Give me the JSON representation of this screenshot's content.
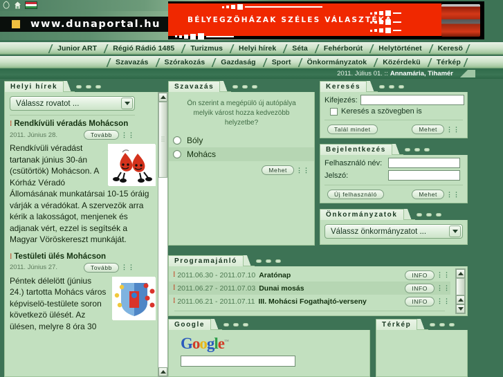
{
  "site": {
    "url_text": "www.dunaportal.hu",
    "icons": [
      "leaf-icon",
      "home-icon",
      "hungarian-flag-icon"
    ]
  },
  "banner": {
    "text": "BÉLYEGZÖHÁZAK SZÉLES VÁLASZTÉKA",
    "bg_color": "#f02800"
  },
  "nav": {
    "row1": [
      "Junior ART",
      "Régió Rádió 1485",
      "Turizmus",
      "Helyi hírek",
      "Séta",
      "Fehérborút",
      "Helytörténet",
      "Keresö"
    ],
    "row2": [
      "Szavazás",
      "Szórakozás",
      "Gazdaság",
      "Sport",
      "Önkormányzatok",
      "Közérdekü",
      "Térkép"
    ]
  },
  "datebar": {
    "date": "2011. Július 01. ::",
    "names": "Annamária, Tihamér"
  },
  "local_news": {
    "title": "Helyi hírek",
    "select_value": "Válassz rovatot ...",
    "more_label": "Tovább",
    "items": [
      {
        "headline": "Rendkívüli véradás Mohácson",
        "date": "2011. Június 28.",
        "body": "Rendkívüli véradást tartanak június 30-án (csütörtök) Mohácson. A Kórház Véradó Állomásának munkatársai 10-15 óráig várják a véradókat. A szervezök arra kérik a lakosságot, menjenek és adjanak vért, ezzel is segítsék a Magyar Vöröskereszt munkáját.",
        "image": "blood-drops-mascot-image"
      },
      {
        "headline": "Testületi ülés Mohácson",
        "date": "2011. Június 27.",
        "body": "Péntek délelött (június 24.) tartotta Mohács város képviselö-testülete soron következö ülését. Az ülésen, melyre 8 óra 30",
        "image": "mohacs-coat-of-arms-image"
      }
    ]
  },
  "poll": {
    "title": "Szavazás",
    "question": "Ön szerint a megépülö új autópálya melyik várost hozza kedvezöbb helyzetbe?",
    "options": [
      "Bóly",
      "Mohács"
    ],
    "submit_label": "Mehet"
  },
  "search": {
    "title": "Keresés",
    "field_label": "Kifejezés:",
    "field_value": "",
    "checkbox_label": "Keresés a szövegben is",
    "find_all_label": "Talál mindet",
    "submit_label": "Mehet"
  },
  "login": {
    "title": "Bejelentkezés",
    "user_label": "Felhasználó név:",
    "user_value": "",
    "pass_label": "Jelszó:",
    "pass_value": "",
    "new_user_label": "Új felhasználó",
    "submit_label": "Mehet"
  },
  "municipalities": {
    "title": "Önkormányzatok",
    "select_value": "Válassz önkormányzatot ..."
  },
  "programs": {
    "title": "Programajánló",
    "info_label": "INFO",
    "rows": [
      {
        "dates": "2011.06.30 - 2011.07.10",
        "name": "Aratónap"
      },
      {
        "dates": "2011.06.27 - 2011.07.03",
        "name": "Dunai mosás"
      },
      {
        "dates": "2011.06.21 - 2011.07.11",
        "name": "III. Mohácsi Fogathajtó-verseny"
      }
    ]
  },
  "google": {
    "title": "Google",
    "logo_letters": [
      "G",
      "o",
      "o",
      "g",
      "l",
      "e"
    ],
    "query_value": ""
  },
  "map": {
    "title": "Térkép"
  },
  "theme": {
    "page_bg": "#3d7355",
    "panel_bg": "#c2e0bf",
    "panel_border": "#9ec49a",
    "accent": "#2f6b4a"
  }
}
